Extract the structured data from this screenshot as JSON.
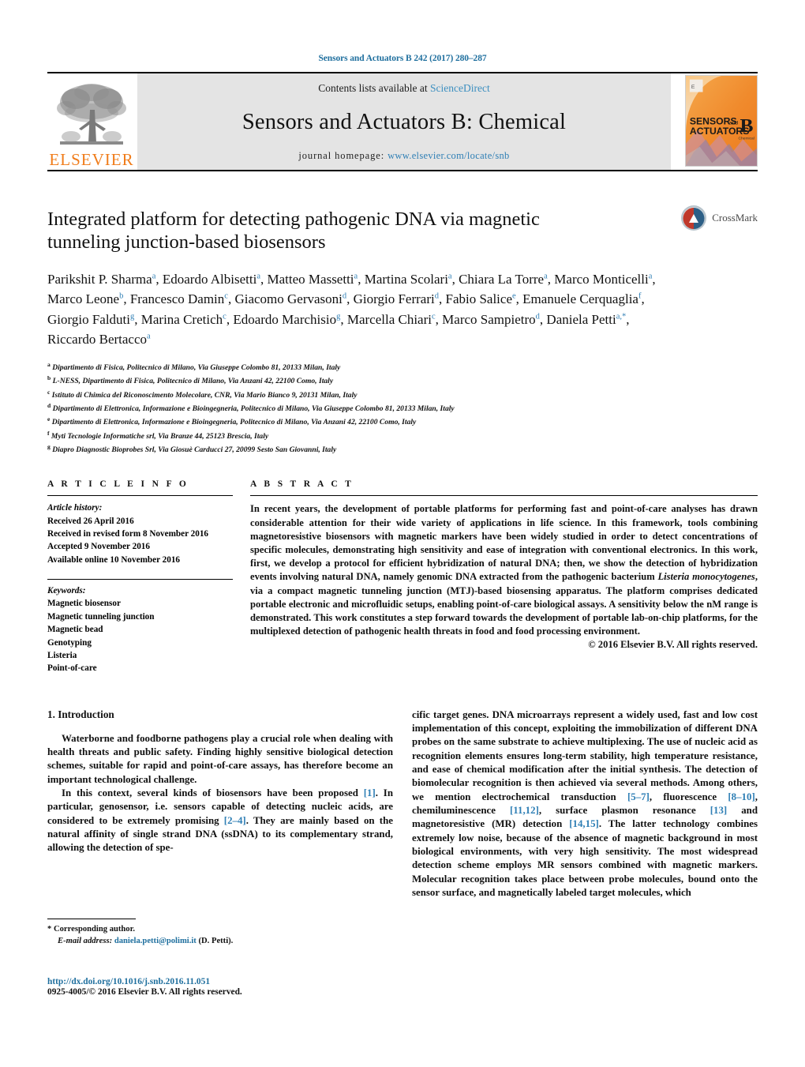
{
  "running_head": "Sensors and Actuators B 242 (2017) 280–287",
  "masthead": {
    "contents_prefix": "Contents lists available at ",
    "sciencedirect": "ScienceDirect",
    "journal_title": "Sensors and Actuators B: Chemical",
    "homepage_label": "journal homepage:",
    "homepage_url": "www.elsevier.com/locate/snb",
    "publisher": "ELSEVIER",
    "cover_line1": "SENSORS",
    "cover_and": "and",
    "cover_line2": "ACTUATORS",
    "cover_letter": "B",
    "cover_sub": "Chemical",
    "colors": {
      "link": "#3c8fc0",
      "elsevier_orange": "#f07c1a",
      "band": "#e4e4e4"
    }
  },
  "article": {
    "title": "Integrated platform for detecting pathogenic DNA via magnetic tunneling junction-based biosensors",
    "crossmark_label": "CrossMark",
    "authors_html": "Parikshit P. Sharma<sup>a</sup>, Edoardo Albisetti<sup>a</sup>, Matteo Massetti<sup>a</sup>, Martina Scolari<sup>a</sup>, Chiara La Torre<sup>a</sup>, Marco Monticelli<sup>a</sup>, Marco Leone<sup>b</sup>, Francesco Damin<sup>c</sup>, Giacomo Gervasoni<sup>d</sup>, Giorgio Ferrari<sup>d</sup>, Fabio Salice<sup>e</sup>, Emanuele Cerquaglia<sup>f</sup>, Giorgio Falduti<sup>g</sup>, Marina Cretich<sup>c</sup>, Edoardo Marchisio<sup>g</sup>, Marcella Chiari<sup>c</sup>, Marco Sampietro<sup>d</sup>, Daniela Petti<sup>a,*</sup>, Riccardo Bertacco<sup>a</sup>",
    "affiliations": [
      {
        "mark": "a",
        "text": "Dipartimento di Fisica, Politecnico di Milano, Via Giuseppe Colombo 81, 20133 Milan, Italy"
      },
      {
        "mark": "b",
        "text": "L-NESS, Dipartimento di Fisica, Politecnico di Milano, Via Anzani 42, 22100 Como, Italy"
      },
      {
        "mark": "c",
        "text": "Istituto di Chimica del Riconoscimento Molecolare, CNR, Via Mario Bianco 9, 20131 Milan, Italy"
      },
      {
        "mark": "d",
        "text": "Dipartimento di Elettronica, Informazione e Bioingegneria, Politecnico di Milano, Via Giuseppe Colombo 81, 20133 Milan, Italy"
      },
      {
        "mark": "e",
        "text": "Dipartimento di Elettronica, Informazione e Bioingegneria, Politecnico di Milano, Via Anzani 42, 22100 Como, Italy"
      },
      {
        "mark": "f",
        "text": "Myti Tecnologie Informatiche srl, Via Branze 44, 25123 Brescia, Italy"
      },
      {
        "mark": "g",
        "text": "Diapro Diagnostic Bioprobes Srl, Via Giosuè Carducci 27, 20099 Sesto San Giovanni, Italy"
      }
    ]
  },
  "article_info": {
    "heading": "A R T I C L E   I N F O",
    "history_label": "Article history:",
    "history": [
      "Received 26 April 2016",
      "Received in revised form 8 November 2016",
      "Accepted 9 November 2016",
      "Available online 10 November 2016"
    ],
    "keywords_label": "Keywords:",
    "keywords": [
      "Magnetic biosensor",
      "Magnetic tunneling junction",
      "Magnetic bead",
      "Genotyping",
      "Listeria",
      "Point-of-care"
    ]
  },
  "abstract": {
    "heading": "A B S T R A C T",
    "text_html": "In recent years, the development of portable platforms for performing fast and point-of-care analyses has drawn considerable attention for their wide variety of applications in life science. In this framework, tools combining magnetoresistive biosensors with magnetic markers have been widely studied in order to detect concentrations of specific molecules, demonstrating high sensitivity and ease of integration with conventional electronics. In this work, first, we develop a protocol for efficient hybridization of natural DNA; then, we show the detection of hybridization events involving natural DNA, namely genomic DNA extracted from the pathogenic bacterium <em>Listeria monocytogenes</em>, via a compact magnetic tunneling junction (MTJ)-based biosensing apparatus. The platform comprises dedicated portable electronic and microfluidic setups, enabling point-of-care biological assays. A sensitivity below the nM range is demonstrated. This work constitutes a step forward towards the development of portable lab-on-chip platforms, for the multiplexed detection of pathogenic health threats in food and food processing environment.",
    "copyright": "© 2016 Elsevier B.V. All rights reserved."
  },
  "body": {
    "intro_heading": "1.  Introduction",
    "left_paragraphs_html": [
      "Waterborne and foodborne pathogens play a crucial role when dealing with health threats and public safety. Finding highly sensitive biological detection schemes, suitable for rapid and point-of-care assays, has therefore become an important technological challenge.",
      "In this context, several kinds of biosensors have been proposed <span class=\"ref\">[1]</span>. In particular, genosensor, i.e. sensors capable of detecting nucleic acids, are considered to be extremely promising <span class=\"ref\">[2–4]</span>. They are mainly based on the natural affinity of single strand DNA (ssDNA) to its complementary strand, allowing the detection of spe-"
    ],
    "right_paragraphs_html": [
      "cific target genes. DNA microarrays represent a widely used, fast and low cost implementation of this concept, exploiting the immobilization of different DNA probes on the same substrate to achieve multiplexing. The use of nucleic acid as recognition elements ensures long-term stability, high temperature resistance, and ease of chemical modification after the initial synthesis. The detection of biomolecular recognition is then achieved via several methods. Among others, we mention electrochemical transduction <span class=\"ref\">[5–7]</span>, fluorescence <span class=\"ref\">[8–10]</span>, chemiluminescence <span class=\"ref\">[11,12]</span>, surface plasmon resonance <span class=\"ref\">[13]</span> and magnetoresistive (MR) detection <span class=\"ref\">[14,15]</span>. The latter technology combines extremely low noise, because of the absence of magnetic background in most biological environments, with very high sensitivity. The most widespread detection scheme employs MR sensors combined with magnetic markers. Molecular recognition takes place between probe molecules, bound onto the sensor surface, and magnetically labeled target molecules, which"
    ]
  },
  "footer": {
    "corresponding_marker": "*",
    "corresponding_label": "Corresponding author.",
    "email_label": "E-mail address:",
    "email": "daniela.petti@polimi.it",
    "email_owner": "(D. Petti).",
    "doi": "http://dx.doi.org/10.1016/j.snb.2016.11.051",
    "issn_line": "0925-4005/© 2016 Elsevier B.V. All rights reserved."
  }
}
